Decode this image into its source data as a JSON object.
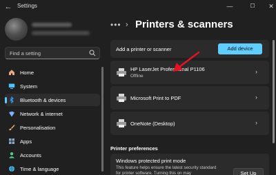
{
  "window": {
    "title": "Settings",
    "back_glyph": "←",
    "minimize_glyph": "—",
    "maximize_glyph": "☐",
    "close_glyph": "✕"
  },
  "search": {
    "placeholder": "Find a setting"
  },
  "sidebar": {
    "items": [
      {
        "label": "Home",
        "icon": "home-icon",
        "active": false
      },
      {
        "label": "System",
        "icon": "system-icon",
        "active": false
      },
      {
        "label": "Bluetooth & devices",
        "icon": "bluetooth-icon",
        "active": true
      },
      {
        "label": "Network & internet",
        "icon": "network-icon",
        "active": false
      },
      {
        "label": "Personalisation",
        "icon": "brush-icon",
        "active": false
      },
      {
        "label": "Apps",
        "icon": "apps-icon",
        "active": false
      },
      {
        "label": "Accounts",
        "icon": "accounts-icon",
        "active": false
      },
      {
        "label": "Time & language",
        "icon": "globe-icon",
        "active": false
      }
    ]
  },
  "main": {
    "breadcrumb_dots": "•••",
    "breadcrumb_sep": "›",
    "title": "Printers & scanners",
    "add_printer": {
      "label": "Add a printer or scanner",
      "button": "Add device"
    },
    "printers": [
      {
        "name": "HP LaserJet Professional P1106",
        "status": "Offline"
      },
      {
        "name": "Microsoft Print to PDF",
        "status": ""
      },
      {
        "name": "OneNote (Desktop)",
        "status": ""
      }
    ],
    "chevron": "›",
    "preferences": {
      "heading": "Printer preferences",
      "protected_mode": {
        "title": "Windows protected print mode",
        "description": "This feature helps ensure the latest security standard for printer software. Turning this on may",
        "button": "Set Up"
      }
    }
  },
  "colors": {
    "background": "#202020",
    "card": "#2b2b2b",
    "accent": "#60cdff",
    "annotation_arrow": "#e81123"
  }
}
